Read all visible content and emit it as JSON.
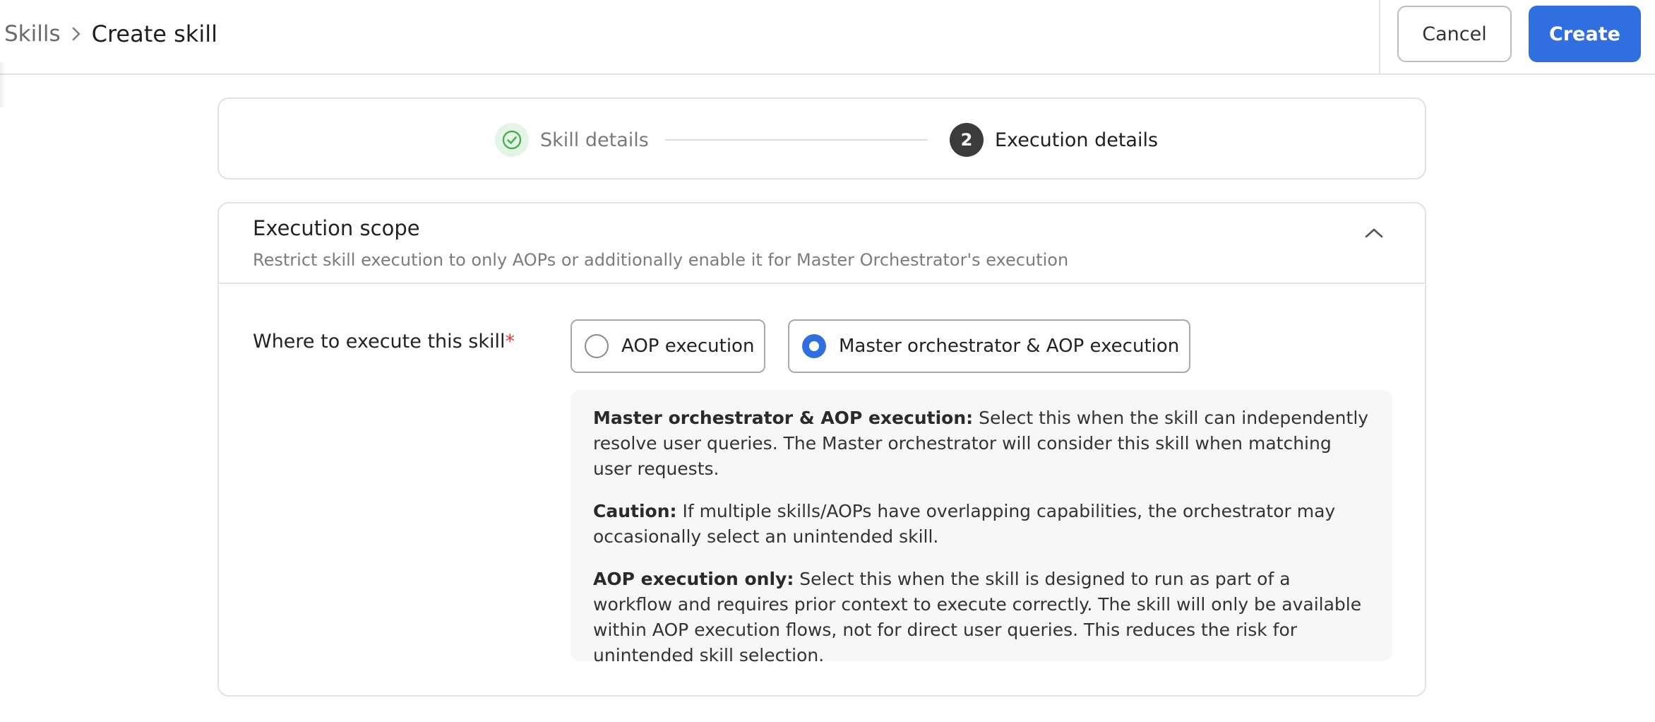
{
  "breadcrumb": {
    "parent": "Skills",
    "current": "Create skill"
  },
  "actions": {
    "cancel_label": "Cancel",
    "create_label": "Create"
  },
  "stepper": {
    "steps": [
      {
        "number": "1",
        "label": "Skill details",
        "state": "completed",
        "icon": "check-circle-icon"
      },
      {
        "number": "2",
        "label": "Execution details",
        "state": "active"
      }
    ]
  },
  "execution_scope": {
    "title": "Execution scope",
    "subtitle": "Restrict skill execution to only AOPs or additionally enable it for Master Orchestrator's execution",
    "collapse_icon": "chevron-up-icon",
    "field_label": "Where to execute this skill",
    "required_marker": "*",
    "options": [
      {
        "label": "AOP execution",
        "selected": false
      },
      {
        "label": "Master orchestrator & AOP execution",
        "selected": true
      }
    ],
    "info": [
      {
        "title": "Master orchestrator & AOP execution:",
        "text": " Select this when the skill can independently resolve user queries. The Master orchestrator will consider this skill when matching user requests."
      },
      {
        "title": "Caution:",
        "text": " If multiple skills/AOPs have overlapping capabilities, the orchestrator may occasionally select an unintended skill."
      },
      {
        "title": "AOP execution only:",
        "text": " Select this when the skill is designed to run as part of a workflow and requires prior context to execute correctly. The skill will only be available within AOP execution flows, not for direct user queries. This reduces the risk for unintended skill selection."
      }
    ]
  },
  "colors": {
    "primary": "#2f6fe0",
    "success": "#4caf50",
    "required": "#e53935"
  }
}
